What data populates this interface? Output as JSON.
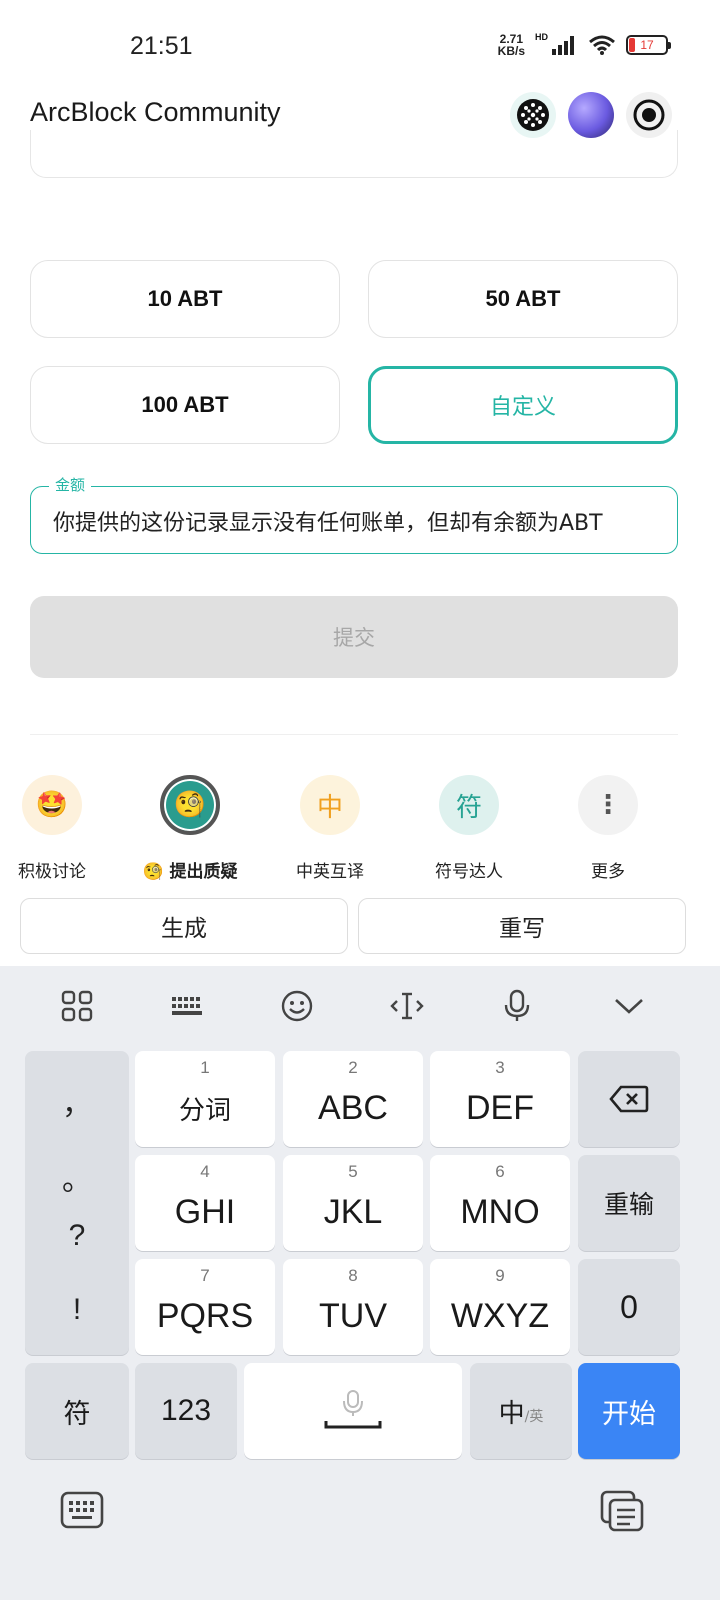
{
  "status": {
    "time": "21:51",
    "net_speed_value": "2.71",
    "net_speed_unit": "KB/s",
    "hd": "HD",
    "battery": "17",
    "battery_level": 0.17
  },
  "header": {
    "title": "ArcBlock Community"
  },
  "amounts": {
    "options": [
      "10 ABT",
      "50 ABT",
      "100 ABT",
      "自定义"
    ],
    "selected": "自定义"
  },
  "amount_field": {
    "label": "金额",
    "value": "你提供的这份记录显示没有任何账单，但却有余额为ABT"
  },
  "submit": {
    "label": "提交"
  },
  "ai_actions": [
    {
      "label": "积极讨论",
      "icon": "star-eyes-emoji-icon",
      "glyph": "🤩"
    },
    {
      "label": "🧐 提出质疑",
      "icon": "monocle-face-icon",
      "glyph": "🧐"
    },
    {
      "label": "中英互译",
      "icon": "translate-icon",
      "glyph": "中"
    },
    {
      "label": "符号达人",
      "icon": "symbol-icon",
      "glyph": "符"
    },
    {
      "label": "更多",
      "icon": "more-vertical-icon",
      "glyph": "⋮"
    }
  ],
  "ai_buttons": {
    "generate": "生成",
    "rewrite": "重写"
  },
  "keyboard": {
    "punctuation": [
      "，",
      "。",
      "?",
      "!"
    ],
    "keys": [
      {
        "num": "1",
        "label": "分词"
      },
      {
        "num": "2",
        "label": "ABC"
      },
      {
        "num": "3",
        "label": "DEF"
      },
      {
        "num": "4",
        "label": "GHI"
      },
      {
        "num": "5",
        "label": "JKL"
      },
      {
        "num": "6",
        "label": "MNO"
      },
      {
        "num": "7",
        "label": "PQRS"
      },
      {
        "num": "8",
        "label": "TUV"
      },
      {
        "num": "9",
        "label": "WXYZ"
      }
    ],
    "reinput": "重输",
    "zero": "0",
    "symbols": "符",
    "numbers": "123",
    "lang_main": "中",
    "lang_alt": "/英",
    "start": "开始"
  }
}
